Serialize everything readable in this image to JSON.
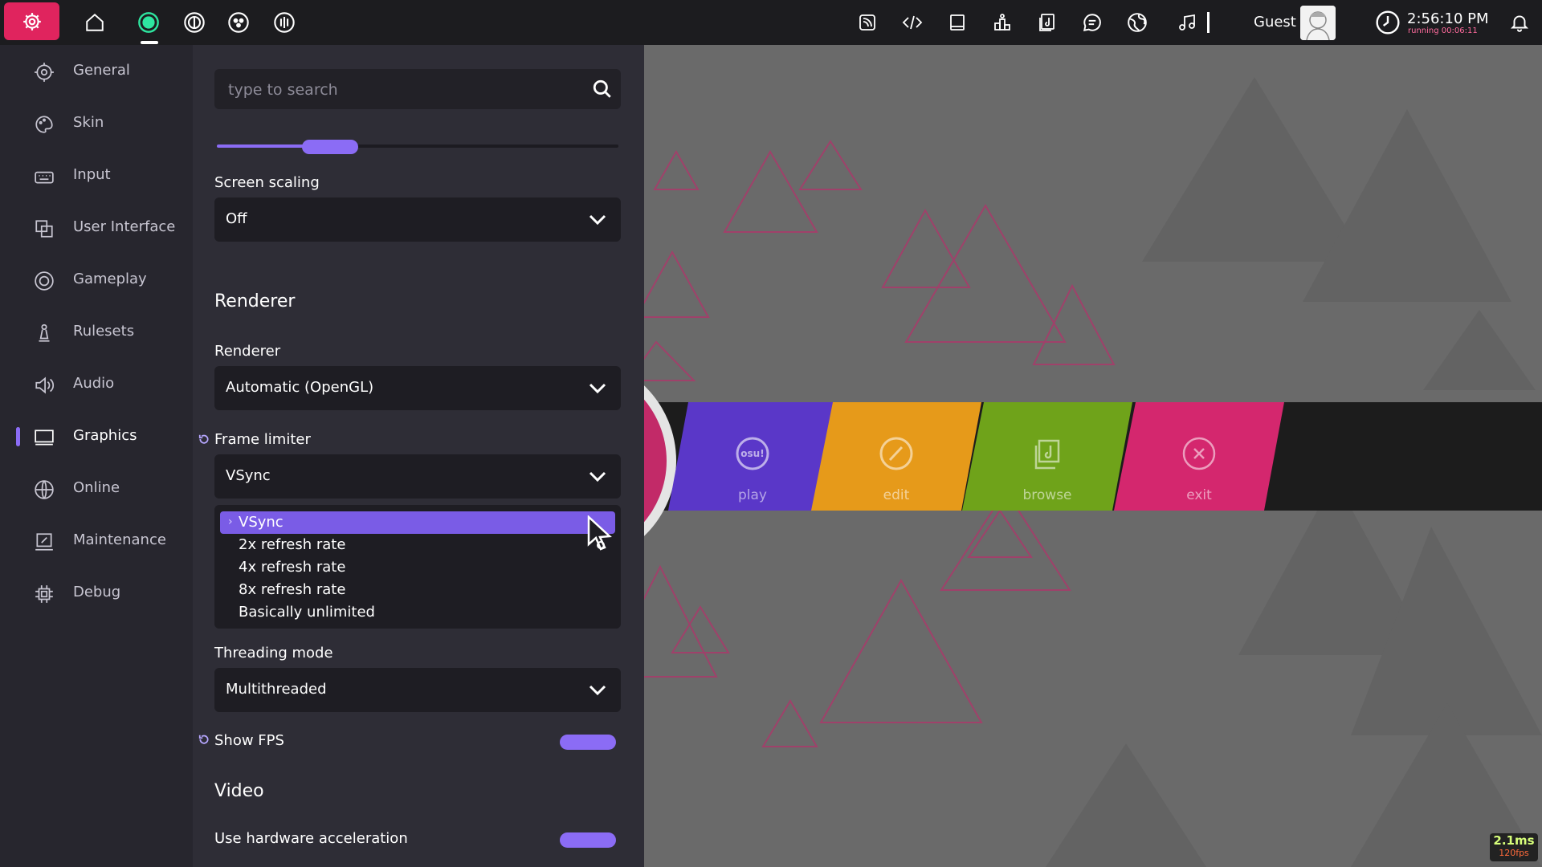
{
  "toolbar": {
    "user_name": "Guest",
    "clock_time": "2:56:10 PM",
    "clock_running": "running 00:06:11",
    "rulesets": [
      "osu",
      "taiko",
      "catch",
      "mania"
    ],
    "right_icons": [
      "news-icon",
      "code-icon",
      "tablet-icon",
      "ranking-icon",
      "beatmap-listing-icon",
      "chat-icon",
      "world-icon",
      "music-icon"
    ]
  },
  "sidebar": {
    "items": [
      {
        "label": "General",
        "icon": "gear-icon"
      },
      {
        "label": "Skin",
        "icon": "palette-icon"
      },
      {
        "label": "Input",
        "icon": "keyboard-icon"
      },
      {
        "label": "User Interface",
        "icon": "layers-icon"
      },
      {
        "label": "Gameplay",
        "icon": "gameplay-icon"
      },
      {
        "label": "Rulesets",
        "icon": "chess-pawn-icon"
      },
      {
        "label": "Audio",
        "icon": "speaker-icon"
      },
      {
        "label": "Graphics",
        "icon": "monitor-icon"
      },
      {
        "label": "Online",
        "icon": "globe-icon"
      },
      {
        "label": "Maintenance",
        "icon": "wrench-icon"
      },
      {
        "label": "Debug",
        "icon": "chip-icon"
      }
    ],
    "active": "Graphics"
  },
  "search": {
    "placeholder": "type to search",
    "value": ""
  },
  "settings": {
    "scaling_slider_fill": 0.29,
    "screen_scaling_label": "Screen scaling",
    "screen_scaling_value": "Off",
    "renderer_section": "Renderer",
    "renderer_label": "Renderer",
    "renderer_value": "Automatic (OpenGL)",
    "frame_limiter_label": "Frame limiter",
    "frame_limiter_value": "VSync",
    "frame_limiter_options": [
      "VSync",
      "2x refresh rate",
      "4x refresh rate",
      "8x refresh rate",
      "Basically unlimited"
    ],
    "threading_label": "Threading mode",
    "threading_value": "Multithreaded",
    "show_fps_label": "Show FPS",
    "show_fps_on": true,
    "video_section": "Video",
    "hw_accel_label": "Use hardware acceleration",
    "hw_accel_on": true
  },
  "main_menu": {
    "buttons": [
      {
        "label": "play",
        "icon_text": "osu!",
        "color": "#5a37c8"
      },
      {
        "label": "edit",
        "color": "#e69a1a"
      },
      {
        "label": "browse",
        "color": "#6fa31a"
      },
      {
        "label": "exit",
        "color": "#d4276e"
      }
    ]
  },
  "frame_stats": {
    "ms": "2.1ms",
    "fps": "120fps"
  },
  "colors": {
    "accent": "#8b6cf5",
    "toolbar_settings": "#e0245e"
  }
}
